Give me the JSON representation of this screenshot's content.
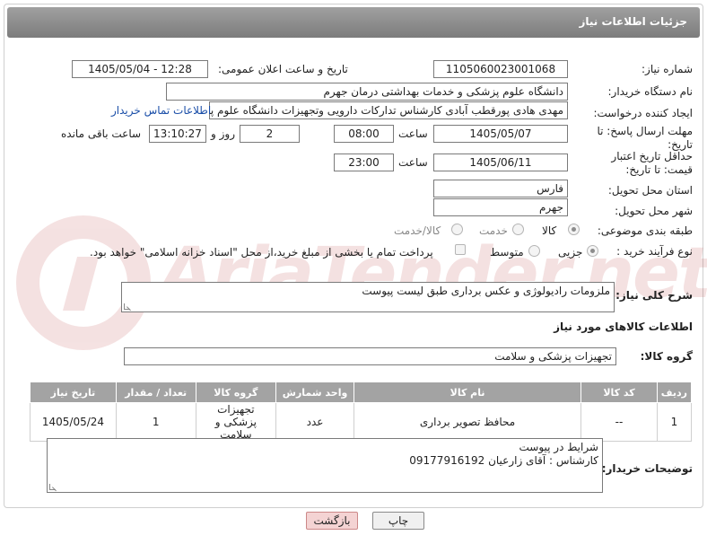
{
  "header": {
    "title": "جزئیات اطلاعات نیاز"
  },
  "watermark": {
    "text": "AriaTender.net"
  },
  "form": {
    "need_number_label": "شماره نیاز:",
    "need_number": "1105060023001068",
    "announce_label": "تاریخ و ساعت اعلان عمومی:",
    "announce_value": "1405/05/04 - 12:28",
    "buyer_org_label": "نام دستگاه خریدار:",
    "buyer_org": "دانشگاه علوم پزشکی و خدمات بهداشتی  درمان جهرم",
    "creator_label": "ایجاد کننده درخواست:",
    "creator": "مهدی هادی پورقطب آبادی کارشناس تدارکات دارویی وتجهیزات دانشگاه علوم پزشکی و خدمات بهداشتی",
    "contact_link": "اطلاعات تماس خریدار",
    "deadline_label": "مهلت ارسال پاسخ: تا تاریخ:",
    "deadline_date": "1405/05/07",
    "time_label": "ساعت",
    "deadline_time": "08:00",
    "days_value": "2",
    "days_label": "روز و",
    "remaining_time": "13:10:27",
    "remaining_label": "ساعت باقی مانده",
    "validity_label": "حداقل تاریخ اعتبار قیمت: تا تاریخ:",
    "validity_date": "1405/06/11",
    "validity_time": "23:00",
    "province_label": "استان محل تحویل:",
    "province": "فارس",
    "city_label": "شهر محل تحویل:",
    "city": "جهرم",
    "category_label": "طبقه بندی موضوعی:",
    "category_options": [
      "کالا",
      "خدمت",
      "کالا/خدمت"
    ],
    "category_selected": "کالا",
    "purchase_type_label": "نوع فرآیند خرید :",
    "purchase_options": [
      "جزیی",
      "متوسط"
    ],
    "purchase_selected": "جزیی",
    "payment_note": "پرداخت تمام یا بخشی از مبلغ خرید،از محل \"اسناد خزانه اسلامی\" خواهد بود.",
    "description_label": "شرح کلی نیاز:",
    "description": "ملزومات رادیولوژی و عکس برداری طبق لیست پیوست",
    "goods_section_title": "اطلاعات کالاهای مورد نیاز",
    "goods_group_label": "گروه کالا:",
    "goods_group": "تجهیزات پزشکی و سلامت"
  },
  "table": {
    "headers": [
      "ردیف",
      "کد کالا",
      "نام کالا",
      "واحد شمارش",
      "گروه کالا",
      "تعداد / مقدار",
      "تاریخ نیاز"
    ],
    "rows": [
      [
        "1",
        "--",
        "محافظ تصویر برداری",
        "عدد",
        "تجهیزات پزشکی و سلامت",
        "1",
        "1405/05/24"
      ]
    ]
  },
  "buyer_notes": {
    "label": "توضیحات خریدار:",
    "line1": "شرایط در پیوست",
    "line2": "کارشناس : آقای زارعیان 09177916192"
  },
  "buttons": {
    "print": "چاپ",
    "back": "بازگشت"
  }
}
